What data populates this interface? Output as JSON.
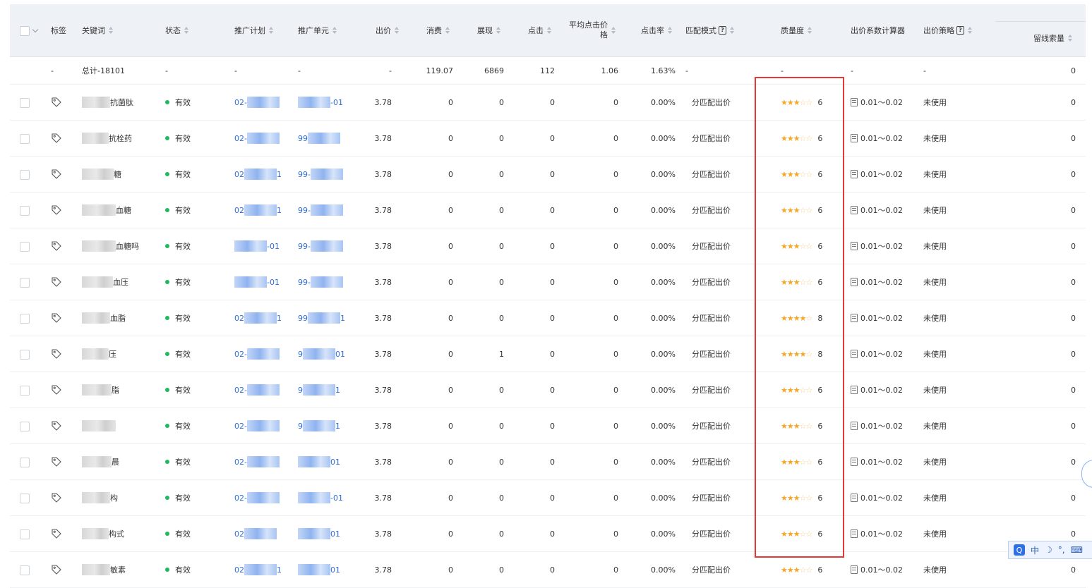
{
  "headers": {
    "tag": "标签",
    "keyword": "关键词",
    "status": "状态",
    "plan": "推广计划",
    "unit": "推广单元",
    "bid": "出价",
    "cost": "消费",
    "impressions": "展现",
    "clicks": "点击",
    "avg_cpc_line1": "平均点击价",
    "avg_cpc_line2": "格",
    "ctr": "点击率",
    "match_mode": "匹配模式",
    "quality": "质量度",
    "bid_calc": "出价系数计算器",
    "bid_strategy": "出价策略",
    "leads": "留线索量"
  },
  "total": {
    "tag": "-",
    "keyword": "总计-18101",
    "status": "-",
    "plan": "-",
    "unit": "-",
    "bid": "-",
    "cost": "119.07",
    "impressions": "6869",
    "clicks": "112",
    "avg_cpc": "1.06",
    "ctr": "1.63%",
    "match_mode": "-",
    "quality": "-",
    "bid_calc": "-",
    "bid_strategy": "-",
    "leads": "0"
  },
  "rows": [
    {
      "keyword_suffix": "抗菌肽",
      "plan_prefix": "02-",
      "plan_suffix": "",
      "unit_prefix": "",
      "unit_suffix": "-01",
      "status": "有效",
      "bid": "3.78",
      "cost": "0",
      "impressions": "0",
      "clicks": "0",
      "avg_cpc": "0",
      "ctr": "0.00%",
      "match_mode": "分匹配出价",
      "stars": 3,
      "quality": "6",
      "bid_calc": "0.01～0.02",
      "bid_strategy": "未使用",
      "leads": "0"
    },
    {
      "keyword_suffix": "抗栓药",
      "plan_prefix": "02-",
      "plan_suffix": "",
      "unit_prefix": "99",
      "unit_suffix": "",
      "status": "有效",
      "bid": "3.78",
      "cost": "0",
      "impressions": "0",
      "clicks": "0",
      "avg_cpc": "0",
      "ctr": "0.00%",
      "match_mode": "分匹配出价",
      "stars": 3,
      "quality": "6",
      "bid_calc": "0.01～0.02",
      "bid_strategy": "未使用",
      "leads": "0"
    },
    {
      "keyword_suffix": "糖",
      "plan_prefix": "02",
      "plan_suffix": "1",
      "unit_prefix": "99-",
      "unit_suffix": "",
      "status": "有效",
      "bid": "3.78",
      "cost": "0",
      "impressions": "0",
      "clicks": "0",
      "avg_cpc": "0",
      "ctr": "0.00%",
      "match_mode": "分匹配出价",
      "stars": 3,
      "quality": "6",
      "bid_calc": "0.01～0.02",
      "bid_strategy": "未使用",
      "leads": "0"
    },
    {
      "keyword_suffix": "血糖",
      "plan_prefix": "02",
      "plan_suffix": "1",
      "unit_prefix": "99-",
      "unit_suffix": "",
      "status": "有效",
      "bid": "3.78",
      "cost": "0",
      "impressions": "0",
      "clicks": "0",
      "avg_cpc": "0",
      "ctr": "0.00%",
      "match_mode": "分匹配出价",
      "stars": 3,
      "quality": "6",
      "bid_calc": "0.01～0.02",
      "bid_strategy": "未使用",
      "leads": "0"
    },
    {
      "keyword_suffix": "血糖吗",
      "plan_prefix": "",
      "plan_suffix": "-01",
      "unit_prefix": "99-",
      "unit_suffix": "",
      "status": "有效",
      "bid": "3.78",
      "cost": "0",
      "impressions": "0",
      "clicks": "0",
      "avg_cpc": "0",
      "ctr": "0.00%",
      "match_mode": "分匹配出价",
      "stars": 3,
      "quality": "6",
      "bid_calc": "0.01～0.02",
      "bid_strategy": "未使用",
      "leads": "0"
    },
    {
      "keyword_suffix": "血压",
      "plan_prefix": "",
      "plan_suffix": "-01",
      "unit_prefix": "99-",
      "unit_suffix": "",
      "status": "有效",
      "bid": "3.78",
      "cost": "0",
      "impressions": "0",
      "clicks": "0",
      "avg_cpc": "0",
      "ctr": "0.00%",
      "match_mode": "分匹配出价",
      "stars": 3,
      "quality": "6",
      "bid_calc": "0.01～0.02",
      "bid_strategy": "未使用",
      "leads": "0"
    },
    {
      "keyword_suffix": "血脂",
      "plan_prefix": "02",
      "plan_suffix": "1",
      "unit_prefix": "99",
      "unit_suffix": "1",
      "status": "有效",
      "bid": "3.78",
      "cost": "0",
      "impressions": "0",
      "clicks": "0",
      "avg_cpc": "0",
      "ctr": "0.00%",
      "match_mode": "分匹配出价",
      "stars": 4,
      "quality": "8",
      "bid_calc": "0.01～0.02",
      "bid_strategy": "未使用",
      "leads": "0"
    },
    {
      "keyword_suffix": "压",
      "plan_prefix": "02-",
      "plan_suffix": "",
      "unit_prefix": "9",
      "unit_suffix": "01",
      "status": "有效",
      "bid": "3.78",
      "cost": "0",
      "impressions": "1",
      "clicks": "0",
      "avg_cpc": "0",
      "ctr": "0.00%",
      "match_mode": "分匹配出价",
      "stars": 4,
      "quality": "8",
      "bid_calc": "0.01～0.02",
      "bid_strategy": "未使用",
      "leads": "0"
    },
    {
      "keyword_suffix": "脂",
      "plan_prefix": "02-",
      "plan_suffix": "",
      "unit_prefix": "9",
      "unit_suffix": "1",
      "status": "有效",
      "bid": "3.78",
      "cost": "0",
      "impressions": "0",
      "clicks": "0",
      "avg_cpc": "0",
      "ctr": "0.00%",
      "match_mode": "分匹配出价",
      "stars": 3,
      "quality": "6",
      "bid_calc": "0.01～0.02",
      "bid_strategy": "未使用",
      "leads": "0"
    },
    {
      "keyword_suffix": "",
      "plan_prefix": "02-",
      "plan_suffix": "",
      "unit_prefix": "9",
      "unit_suffix": "1",
      "status": "有效",
      "bid": "3.78",
      "cost": "0",
      "impressions": "0",
      "clicks": "0",
      "avg_cpc": "0",
      "ctr": "0.00%",
      "match_mode": "分匹配出价",
      "stars": 3,
      "quality": "6",
      "bid_calc": "0.01～0.02",
      "bid_strategy": "未使用",
      "leads": "0"
    },
    {
      "keyword_suffix": "晨",
      "plan_prefix": "02-",
      "plan_suffix": "",
      "unit_prefix": "",
      "unit_suffix": "01",
      "status": "有效",
      "bid": "3.78",
      "cost": "0",
      "impressions": "0",
      "clicks": "0",
      "avg_cpc": "0",
      "ctr": "0.00%",
      "match_mode": "分匹配出价",
      "stars": 3,
      "quality": "6",
      "bid_calc": "0.01～0.02",
      "bid_strategy": "未使用",
      "leads": "0"
    },
    {
      "keyword_suffix": "构",
      "plan_prefix": "02-",
      "plan_suffix": "",
      "unit_prefix": "",
      "unit_suffix": "-01",
      "status": "有效",
      "bid": "3.78",
      "cost": "0",
      "impressions": "0",
      "clicks": "0",
      "avg_cpc": "0",
      "ctr": "0.00%",
      "match_mode": "分匹配出价",
      "stars": 3,
      "quality": "6",
      "bid_calc": "0.01～0.02",
      "bid_strategy": "未使用",
      "leads": "0"
    },
    {
      "keyword_suffix": "构式",
      "plan_prefix": "02",
      "plan_suffix": "",
      "unit_prefix": "",
      "unit_suffix": "01",
      "status": "有效",
      "bid": "3.78",
      "cost": "0",
      "impressions": "0",
      "clicks": "0",
      "avg_cpc": "0",
      "ctr": "0.00%",
      "match_mode": "分匹配出价",
      "stars": 3,
      "quality": "6",
      "bid_calc": "0.01～0.02",
      "bid_strategy": "未使用",
      "leads": "0"
    },
    {
      "keyword_suffix": "敏素",
      "plan_prefix": "02",
      "plan_suffix": "1",
      "unit_prefix": "",
      "unit_suffix": "01",
      "status": "有效",
      "bid": "3.78",
      "cost": "0",
      "impressions": "0",
      "clicks": "0",
      "avg_cpc": "0",
      "ctr": "0.00%",
      "match_mode": "分匹配出价",
      "stars": 3,
      "quality": "6",
      "bid_calc": "0.01～0.02",
      "bid_strategy": "未使用",
      "leads": "0"
    }
  ],
  "ime": {
    "logo": "Q",
    "lang": "中",
    "moon": "☽",
    "dots": "°,",
    "keyboard": "⌨"
  },
  "colors": {
    "accent": "#2e6fd8",
    "highlight": "#e53935",
    "star": "#f5a623",
    "status_ok": "#1fb85f"
  },
  "icons": {
    "tag": "tag-icon",
    "calc": "calculator-icon",
    "help": "help-icon"
  }
}
